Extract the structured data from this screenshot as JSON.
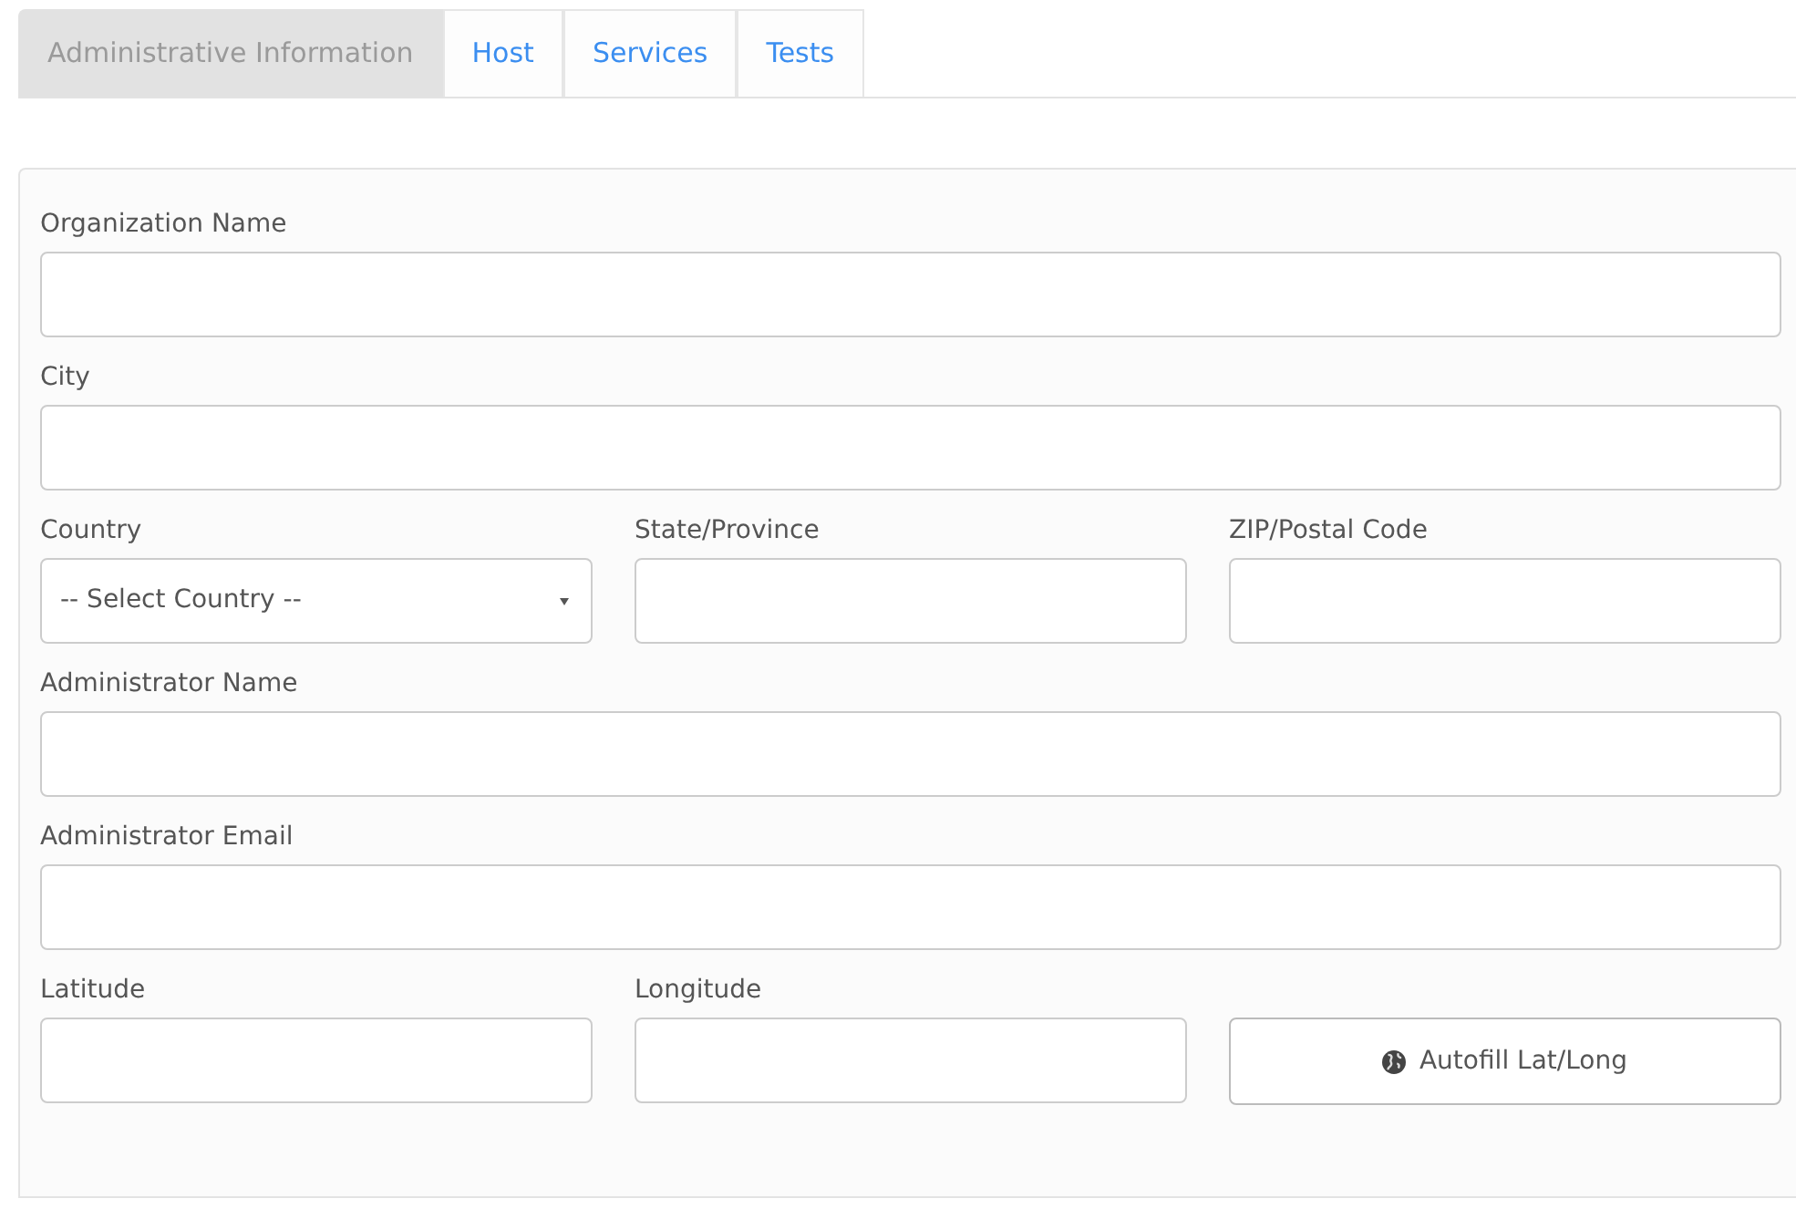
{
  "tabs": [
    {
      "label": "Administrative Information",
      "selected": true
    },
    {
      "label": "Host",
      "selected": false
    },
    {
      "label": "Services",
      "selected": false
    },
    {
      "label": "Tests",
      "selected": false
    }
  ],
  "form": {
    "rows": [
      {
        "fields": [
          {
            "kind": "text",
            "label": "Organization Name"
          }
        ]
      },
      {
        "fields": [
          {
            "kind": "text",
            "label": "City"
          }
        ]
      },
      {
        "fields": [
          {
            "kind": "select",
            "label": "Country",
            "value": "-- Select Country --"
          },
          {
            "kind": "text",
            "label": "State/Province"
          },
          {
            "kind": "text",
            "label": "ZIP/Postal Code"
          }
        ]
      },
      {
        "fields": [
          {
            "kind": "text",
            "label": "Administrator Name"
          }
        ]
      },
      {
        "fields": [
          {
            "kind": "text",
            "label": "Administrator Email"
          }
        ]
      },
      {
        "fields": [
          {
            "kind": "text",
            "label": "Latitude"
          },
          {
            "kind": "text",
            "label": "Longitude"
          },
          {
            "kind": "button",
            "label": "Autofill Lat/Long"
          }
        ]
      }
    ]
  }
}
